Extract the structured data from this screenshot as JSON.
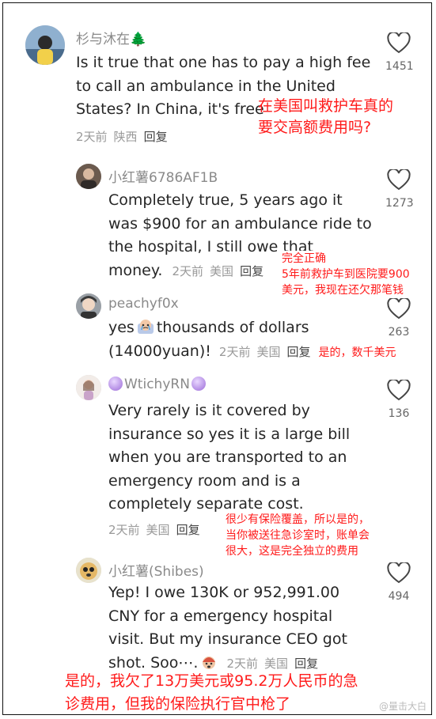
{
  "comments": [
    {
      "username": "杉与沐在🌲",
      "lines": [
        "Is it true that one has to pay a high fee",
        "to call an ambulance in the United",
        "States? In China, it's free"
      ],
      "time": "2天前",
      "location": "陕西",
      "reply": "回复",
      "likes": "1451",
      "translation": [
        "在美国叫救护车真的",
        "要交高额费用吗?"
      ]
    },
    {
      "username": "小红薯6786AF1B",
      "lines": [
        "Completely true, 5 years ago it",
        "was $900 for an ambulance ride to",
        "the hospital, I still owe that"
      ],
      "last_line": "money.",
      "time": "2天前",
      "location": "美国",
      "reply": "回复",
      "likes": "1273",
      "translation": [
        "完全正确",
        "5年前救护车到医院要900",
        "美元，我现在还欠那笔钱"
      ]
    },
    {
      "username": "peachyf0x",
      "line1": "yes",
      "line1_after": "thousands of dollars",
      "line2": "(14000yuan)!",
      "time": "2天前",
      "location": "美国",
      "reply": "回复",
      "likes": "263",
      "translation": [
        "是的，数千美元"
      ]
    },
    {
      "username": "WtichyRN",
      "lines": [
        "Very rarely is it covered by",
        "insurance so yes it is a large bill",
        "when you are transported to an",
        "emergency room and is a",
        "completely separate cost."
      ],
      "time": "2天前",
      "location": "美国",
      "reply": "回复",
      "likes": "136",
      "translation": [
        "很少有保险覆盖，所以是的，",
        "当你被送往急诊室时，账单会",
        "很大，这是完全独立的费用"
      ]
    },
    {
      "username": "小红薯(Shibes)",
      "lines": [
        "Yep! I owe 130K or 952,991.00",
        "CNY for a emergency hospital",
        "visit. But my insurance CEO got"
      ],
      "last_line": "shot. Soo⋯.",
      "time": "2天前",
      "location": "美国",
      "reply": "回复",
      "likes": "494",
      "translation": [
        "是的，我欠了13万美元或95.2万人民币的急",
        "诊费用，但我的保险执行官中枪了"
      ]
    }
  ],
  "watermark": "@量击大白",
  "colors": {
    "annotation": "#ff1a1a",
    "username": "#8a8a8a",
    "body_text": "#262626"
  }
}
